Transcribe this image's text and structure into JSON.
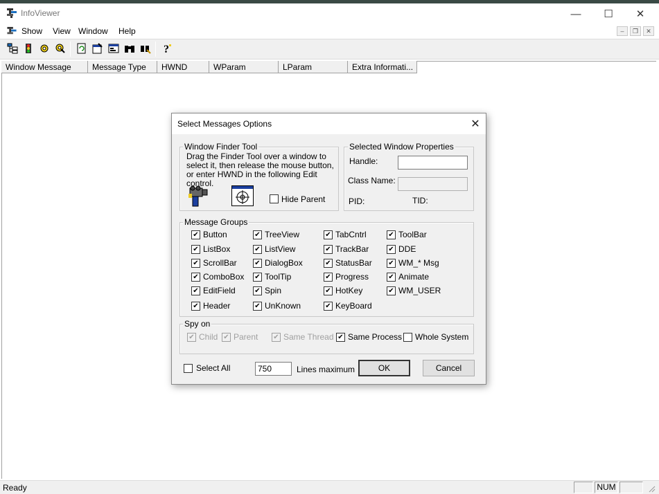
{
  "window": {
    "title": "InfoViewer",
    "minimize": "—",
    "maximize": "☐",
    "close": "✕"
  },
  "menu": {
    "items": [
      "Show",
      "View",
      "Window",
      "Help"
    ],
    "mdi": [
      "–",
      "❐",
      "✕"
    ]
  },
  "toolbar": {
    "icons": [
      "tree-icon",
      "traffic-light-icon",
      "gear-icon",
      "tools-icon",
      "refresh-icon",
      "properties-icon",
      "window-icon",
      "binoculars-icon",
      "find-icon",
      "help-icon"
    ]
  },
  "list": {
    "columns": [
      "Window Message",
      "Message Type",
      "HWND",
      "WParam",
      "LParam",
      "Extra Informati..."
    ]
  },
  "status": {
    "text": "Ready",
    "num": "NUM"
  },
  "dialog": {
    "title": "Select Messages Options",
    "close": "✕",
    "finder": {
      "label": "Window Finder Tool",
      "instructions": "Drag the Finder Tool over a window to select it, then release the mouse button, or enter HWND in the following Edit control.",
      "hide_parent": "Hide Parent",
      "hide_parent_checked": false
    },
    "props": {
      "label": "Selected Window Properties",
      "handle_label": "Handle:",
      "handle_value": "",
      "class_label": "Class Name:",
      "class_value": "",
      "pid_label": "PID:",
      "tid_label": "TID:"
    },
    "groups": {
      "label": "Message Groups",
      "items": [
        {
          "label": "Button",
          "checked": true
        },
        {
          "label": "TreeView",
          "checked": true
        },
        {
          "label": "TabCntrl",
          "checked": true
        },
        {
          "label": "ToolBar",
          "checked": true
        },
        {
          "label": "ListBox",
          "checked": true
        },
        {
          "label": "ListView",
          "checked": true
        },
        {
          "label": "TrackBar",
          "checked": true
        },
        {
          "label": "DDE",
          "checked": true
        },
        {
          "label": "ScrollBar",
          "checked": true
        },
        {
          "label": "DialogBox",
          "checked": true
        },
        {
          "label": "StatusBar",
          "checked": true
        },
        {
          "label": "WM_* Msg",
          "checked": true
        },
        {
          "label": "ComboBox",
          "checked": true
        },
        {
          "label": "ToolTip",
          "checked": true
        },
        {
          "label": "Progress",
          "checked": true
        },
        {
          "label": "Animate",
          "checked": true
        },
        {
          "label": "EditField",
          "checked": true
        },
        {
          "label": "Spin",
          "checked": true
        },
        {
          "label": "HotKey",
          "checked": true
        },
        {
          "label": "WM_USER",
          "checked": true
        },
        {
          "label": "Header",
          "checked": true
        },
        {
          "label": "UnKnown",
          "checked": true
        },
        {
          "label": "KeyBoard",
          "checked": true
        }
      ]
    },
    "spy": {
      "label": "Spy on",
      "items": [
        {
          "label": "Child",
          "checked": true,
          "disabled": true
        },
        {
          "label": "Parent",
          "checked": true,
          "disabled": true
        },
        {
          "label": "Same Thread",
          "checked": true,
          "disabled": true
        },
        {
          "label": "Same Process",
          "checked": true,
          "disabled": false
        },
        {
          "label": "Whole System",
          "checked": false,
          "disabled": false
        }
      ]
    },
    "select_all": "Select All",
    "select_all_checked": false,
    "lines_value": "750",
    "lines_label": "Lines maximum",
    "ok": "OK",
    "cancel": "Cancel"
  }
}
